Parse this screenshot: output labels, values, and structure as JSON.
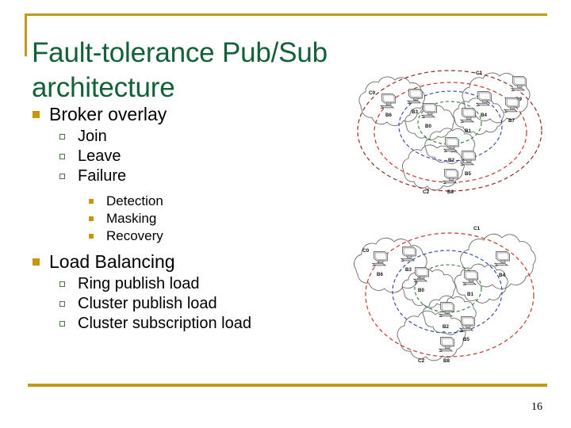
{
  "slide": {
    "title": "Fault-tolerance Pub/Sub architecture",
    "page_number": "16",
    "accent_gold": "#bf9b18",
    "title_green": "#136137",
    "bullet_gold": "#c8960c",
    "bullet_green_outline": "#4d7345"
  },
  "outline": [
    {
      "level": 1,
      "text": "Broker overlay",
      "marker": "filled-square-gold"
    },
    {
      "level": 2,
      "text": "Join",
      "marker": "hollow-square-green"
    },
    {
      "level": 2,
      "text": "Leave",
      "marker": "hollow-square-green"
    },
    {
      "level": 2,
      "text": "Failure",
      "marker": "hollow-square-green"
    },
    {
      "level": 3,
      "text": "Detection",
      "marker": "filled-square-gold-small"
    },
    {
      "level": 3,
      "text": "Masking",
      "marker": "filled-square-gold-small"
    },
    {
      "level": 3,
      "text": "Recovery",
      "marker": "filled-square-gold-small"
    },
    {
      "level": 1,
      "text": "Load Balancing",
      "marker": "filled-square-gold"
    },
    {
      "level": 2,
      "text": "Ring publish load",
      "marker": "hollow-square-green"
    },
    {
      "level": 2,
      "text": "Cluster publish load",
      "marker": "hollow-square-green"
    },
    {
      "level": 2,
      "text": "Cluster subscription load",
      "marker": "hollow-square-green"
    }
  ],
  "diagrams": [
    {
      "name": "broker-overlay-diagram-top",
      "clusters": [
        "C0",
        "C1",
        "C2"
      ],
      "brokers": [
        "B6",
        "B3",
        "B0",
        "B9",
        "B4",
        "B7",
        "B1",
        "B2",
        "B5",
        "B8"
      ],
      "ring_colors": [
        "#c0392b",
        "#8c2b24",
        "#2b3fa0",
        "#2d7a34"
      ]
    },
    {
      "name": "broker-overlay-diagram-bottom",
      "clusters": [
        "C0",
        "C1",
        "C2"
      ],
      "brokers": [
        "B6",
        "B3",
        "B0",
        "B4",
        "B1",
        "B2",
        "B5",
        "B8"
      ],
      "ring_colors": [
        "#c0392b",
        "#2b3fa0",
        "#2d7a34"
      ]
    }
  ],
  "cluster_labels": {
    "c0": "C0",
    "c1": "C1",
    "c2": "C2"
  },
  "broker_labels": {
    "b0": "B0",
    "b1": "B1",
    "b2": "B2",
    "b3": "B3",
    "b4": "B4",
    "b5": "B5",
    "b6": "B6",
    "b7": "B7",
    "b8": "B8",
    "b9": "B9"
  }
}
